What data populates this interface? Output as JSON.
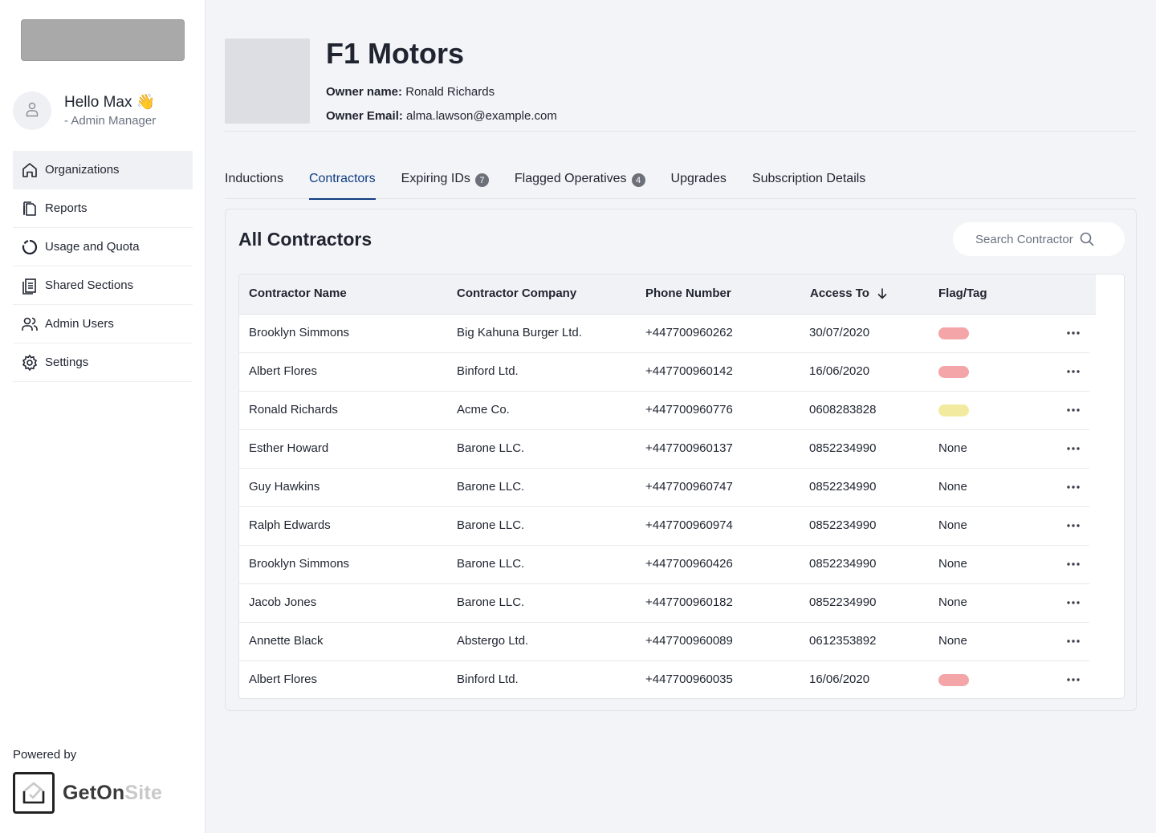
{
  "sidebar": {
    "greeting": "Hello Max 👋",
    "role": "- Admin Manager",
    "items": [
      {
        "label": "Organizations",
        "icon": "home-icon",
        "active": true
      },
      {
        "label": "Reports",
        "icon": "documents-icon",
        "active": false
      },
      {
        "label": "Usage and Quota",
        "icon": "pie-chart-icon",
        "active": false
      },
      {
        "label": "Shared Sections",
        "icon": "file-list-icon",
        "active": false
      },
      {
        "label": "Admin Users",
        "icon": "users-icon",
        "active": false
      },
      {
        "label": "Settings",
        "icon": "gear-icon",
        "active": false
      }
    ],
    "powered_by": "Powered by",
    "brand_part1": "GetOn",
    "brand_part2": "Site"
  },
  "header": {
    "title": "F1 Motors",
    "owner_name_label": "Owner name:",
    "owner_name": "Ronald Richards",
    "owner_email_label": "Owner Email:",
    "owner_email": "alma.lawson@example.com"
  },
  "tabs": [
    {
      "label": "Inductions",
      "badge": null,
      "active": false
    },
    {
      "label": "Contractors",
      "badge": null,
      "active": true
    },
    {
      "label": "Expiring IDs",
      "badge": "7",
      "active": false
    },
    {
      "label": "Flagged Operatives",
      "badge": "4",
      "active": false
    },
    {
      "label": "Upgrades",
      "badge": null,
      "active": false
    },
    {
      "label": "Subscription Details",
      "badge": null,
      "active": false
    }
  ],
  "contractors": {
    "title": "All Contractors",
    "search_placeholder": "Search Contractor",
    "columns": [
      "Contractor Name",
      "Contractor Company",
      "Phone Number",
      "Access To",
      "Flag/Tag"
    ],
    "colors": {
      "red_flag": "#f3a5a8",
      "yellow_flag": "#f2eb9f",
      "accent": "#0f3c82"
    },
    "rows": [
      {
        "name": "Brooklyn Simmons",
        "company": "Big Kahuna Burger Ltd.",
        "phone": "+447700960262",
        "access": "30/07/2020",
        "flag": "red",
        "flag_text": ""
      },
      {
        "name": "Albert Flores",
        "company": "Binford Ltd.",
        "phone": "+447700960142",
        "access": "16/06/2020",
        "flag": "red",
        "flag_text": ""
      },
      {
        "name": "Ronald Richards",
        "company": "Acme Co.",
        "phone": "+447700960776",
        "access": "0608283828",
        "flag": "yellow",
        "flag_text": ""
      },
      {
        "name": "Esther Howard",
        "company": "Barone LLC.",
        "phone": "+447700960137",
        "access": "0852234990",
        "flag": "none",
        "flag_text": "None"
      },
      {
        "name": "Guy Hawkins",
        "company": "Barone LLC.",
        "phone": "+447700960747",
        "access": "0852234990",
        "flag": "none",
        "flag_text": "None"
      },
      {
        "name": "Ralph Edwards",
        "company": "Barone LLC.",
        "phone": "+447700960974",
        "access": "0852234990",
        "flag": "none",
        "flag_text": "None"
      },
      {
        "name": "Brooklyn Simmons",
        "company": "Barone LLC.",
        "phone": "+447700960426",
        "access": "0852234990",
        "flag": "none",
        "flag_text": "None"
      },
      {
        "name": "Jacob Jones",
        "company": "Barone LLC.",
        "phone": "+447700960182",
        "access": "0852234990",
        "flag": "none",
        "flag_text": "None"
      },
      {
        "name": "Annette Black",
        "company": "Abstergo Ltd.",
        "phone": "+447700960089",
        "access": "0612353892",
        "flag": "none",
        "flag_text": "None"
      },
      {
        "name": "Albert Flores",
        "company": "Binford Ltd.",
        "phone": "+447700960035",
        "access": "16/06/2020",
        "flag": "red",
        "flag_text": ""
      }
    ]
  }
}
